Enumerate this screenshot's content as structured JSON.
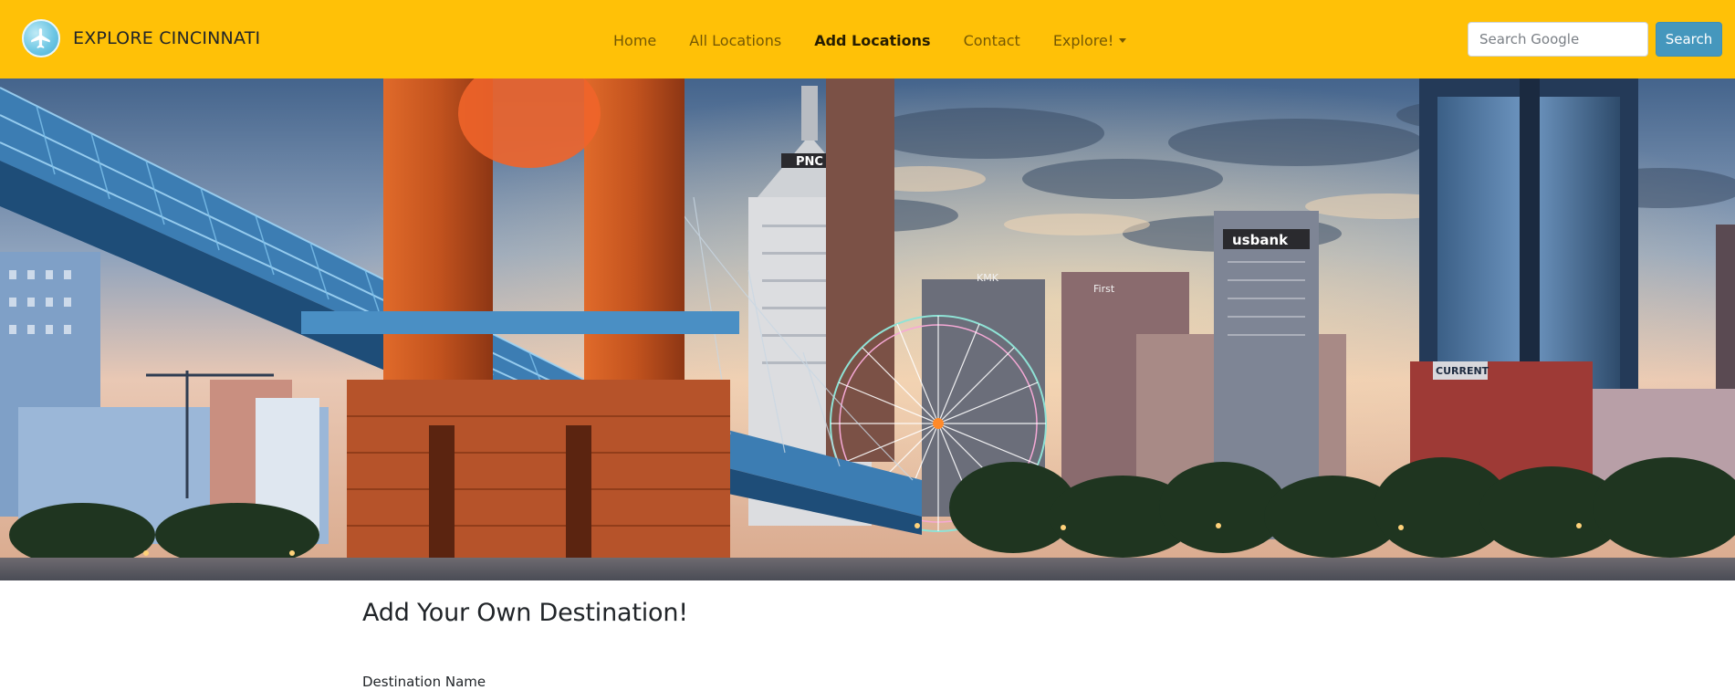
{
  "brand": {
    "name": "EXPLORE CINCINNATI",
    "logo_icon": "airplane-icon"
  },
  "nav": {
    "items": [
      {
        "label": "Home",
        "active": false
      },
      {
        "label": "All Locations",
        "active": false
      },
      {
        "label": "Add Locations",
        "active": true
      },
      {
        "label": "Contact",
        "active": false
      },
      {
        "label": "Explore!",
        "active": false,
        "dropdown": true
      }
    ]
  },
  "search": {
    "placeholder": "Search Google",
    "value": "",
    "button_label": "Search"
  },
  "hero": {
    "sign_pnc": "PNC",
    "sign_usbank": "usbank",
    "sign_first": "First",
    "sign_kmk": "KMK",
    "sign_current": "CURRENT"
  },
  "main": {
    "heading": "Add Your Own Destination!",
    "first_field_label": "Destination Name"
  },
  "colors": {
    "navbar_bg": "#ffc107",
    "search_button_bg": "#4597bd"
  }
}
